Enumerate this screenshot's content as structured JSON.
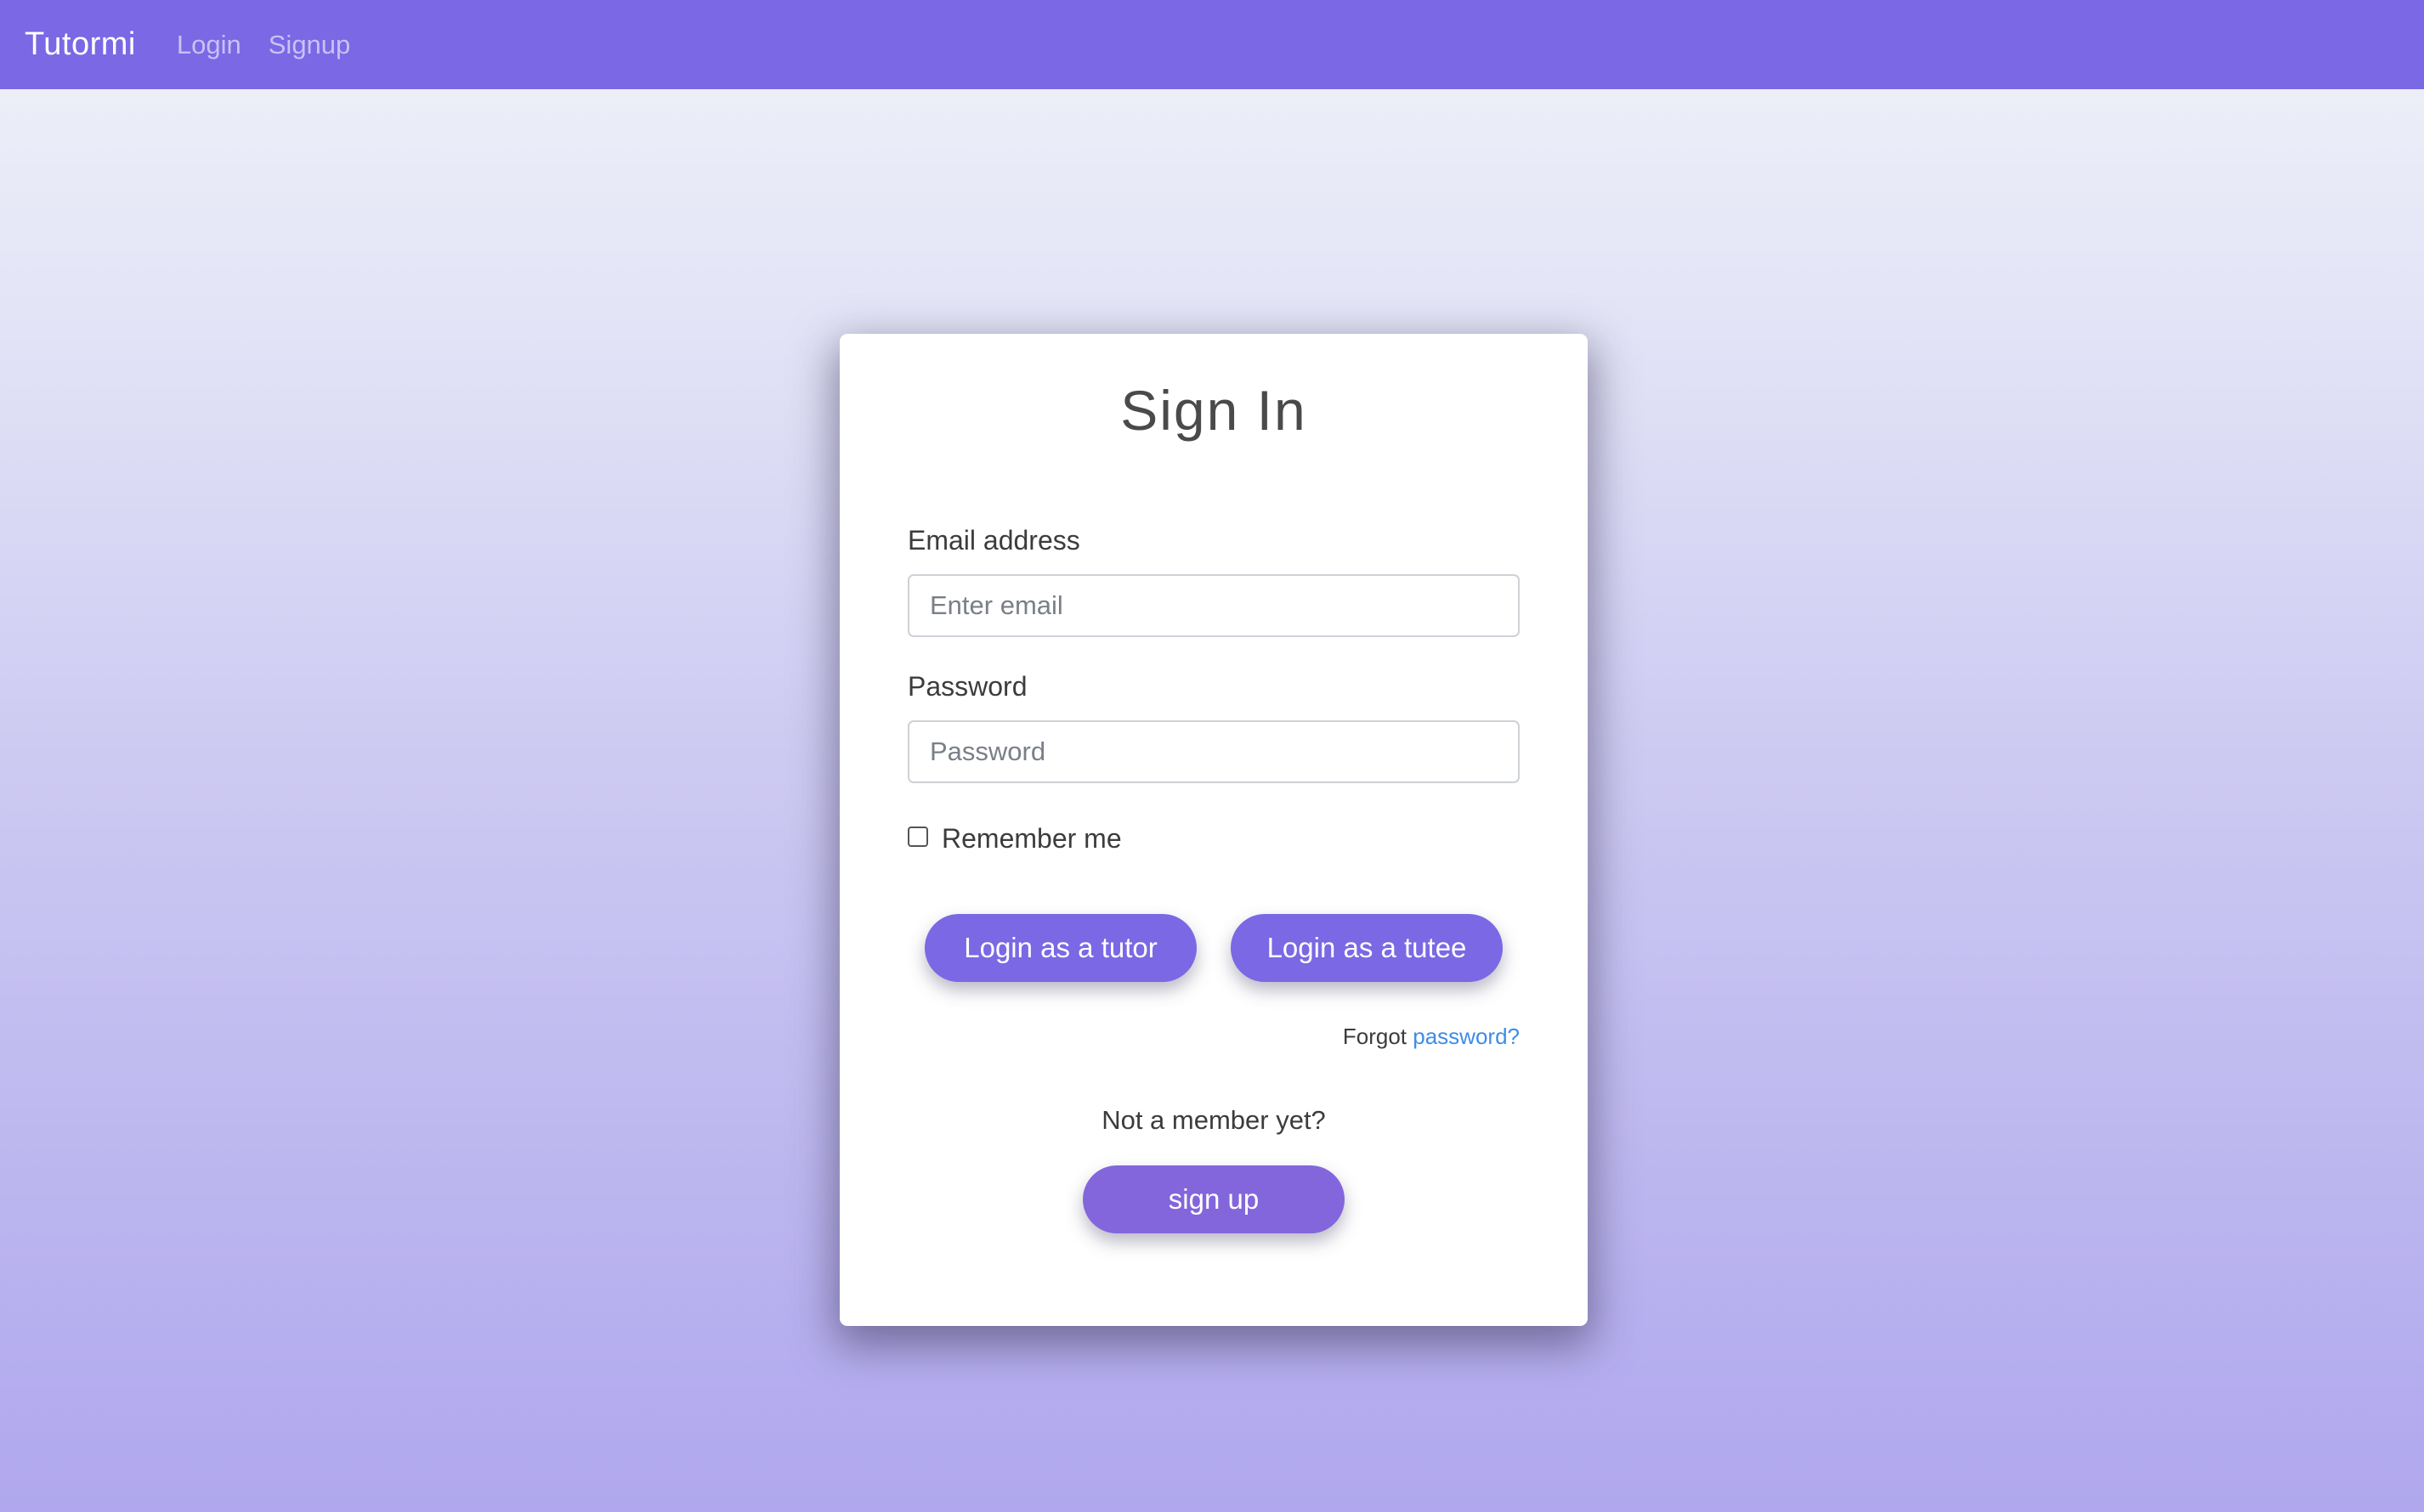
{
  "navbar": {
    "brand": "Tutormi",
    "links": [
      "Login",
      "Signup"
    ]
  },
  "form": {
    "title": "Sign In",
    "email_label": "Email address",
    "email_placeholder": "Enter email",
    "email_value": "",
    "password_label": "Password",
    "password_placeholder": "Password",
    "password_value": "",
    "remember_label": "Remember me",
    "remember_checked": false,
    "login_tutor_label": "Login as a tutor",
    "login_tutee_label": "Login as a tutee",
    "forgot_prefix": "Forgot",
    "forgot_link": "password?",
    "member_prompt": "Not a member yet?",
    "signup_label": "sign up"
  },
  "colors": {
    "accent": "#7b68e4",
    "link": "#3e8ce8",
    "nav_link": "#c9c1f5"
  }
}
